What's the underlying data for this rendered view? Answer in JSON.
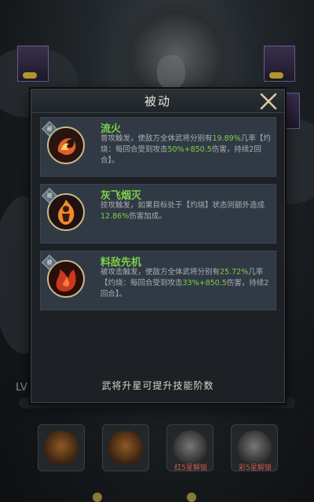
{
  "panel": {
    "title": "被动",
    "footer_note": "武将升星可提升技能阶数"
  },
  "skills": [
    {
      "name": "流火",
      "badge": "被",
      "desc": [
        {
          "t": "普攻触发，使敌方全体武将分别有",
          "hl": false
        },
        {
          "t": "19.89%",
          "hl": true
        },
        {
          "t": "几率【灼烧：每回合受到攻击",
          "hl": false
        },
        {
          "t": "50%+850.5",
          "hl": true
        },
        {
          "t": "伤害，持续2回合】。",
          "hl": false
        }
      ],
      "icon_color": "#e0602a"
    },
    {
      "name": "灰飞烟灭",
      "badge": "被",
      "desc": [
        {
          "t": "技攻触发，如果目标处于【灼烧】状态则额外造成",
          "hl": false
        },
        {
          "t": "12.86%",
          "hl": true
        },
        {
          "t": "伤害加成。",
          "hl": false
        }
      ],
      "icon_color": "#f08a2a"
    },
    {
      "name": "料敌先机",
      "badge": "被",
      "desc": [
        {
          "t": "被攻击触发，使敌方全体武将分别有",
          "hl": false
        },
        {
          "t": "25.72%",
          "hl": true
        },
        {
          "t": "几率【灼烧：每回合受到攻击",
          "hl": false
        },
        {
          "t": "33%+850.5",
          "hl": true
        },
        {
          "t": "伤害，持续2回合】。",
          "hl": false
        }
      ],
      "icon_color": "#c83a20"
    }
  ],
  "background": {
    "level_prefix": "LV",
    "locked_slot_labels": [
      "红5星解锁",
      "彩5星解锁"
    ]
  }
}
